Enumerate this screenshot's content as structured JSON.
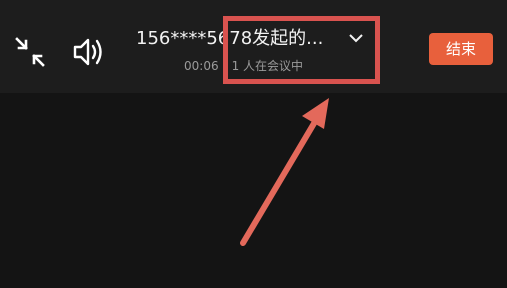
{
  "header": {
    "meeting_title": "156****5678发起的...",
    "duration": "00:06",
    "participants": "1 人在会议中",
    "end_label": "结束"
  },
  "icons": {
    "minimize": "minimize-icon",
    "speaker": "speaker-icon",
    "chevron": "chevron-down-icon"
  },
  "colors": {
    "end_button": "#e8603c",
    "annotation": "#d9534f",
    "background": "#141414",
    "topbar": "#1d1d1d"
  }
}
